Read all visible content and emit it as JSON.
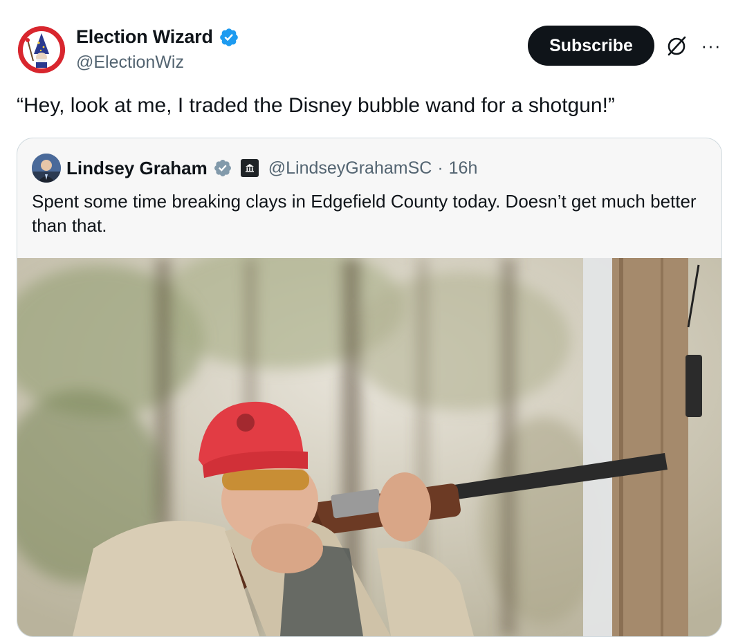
{
  "author": {
    "display_name": "Election Wizard",
    "handle": "@ElectionWiz"
  },
  "actions": {
    "subscribe_label": "Subscribe",
    "more_label": "···"
  },
  "tweet": {
    "text": "“Hey, look at me, I traded the Disney bubble wand for a shotgun!”"
  },
  "quoted": {
    "display_name": "Lindsey Graham",
    "handle": "@LindseyGrahamSC",
    "separator": "·",
    "time": "16h",
    "text": "Spent some time breaking clays in Edgefield County today. Doesn’t get much better than that."
  },
  "colors": {
    "verified_blue": "#1d9bf0",
    "verified_gray": "#829aab",
    "subscribe_bg": "#0f1419",
    "handle_gray": "#536471"
  },
  "icons": [
    "verified-badge-icon",
    "grok-icon",
    "more-icon",
    "government-badge-icon"
  ]
}
